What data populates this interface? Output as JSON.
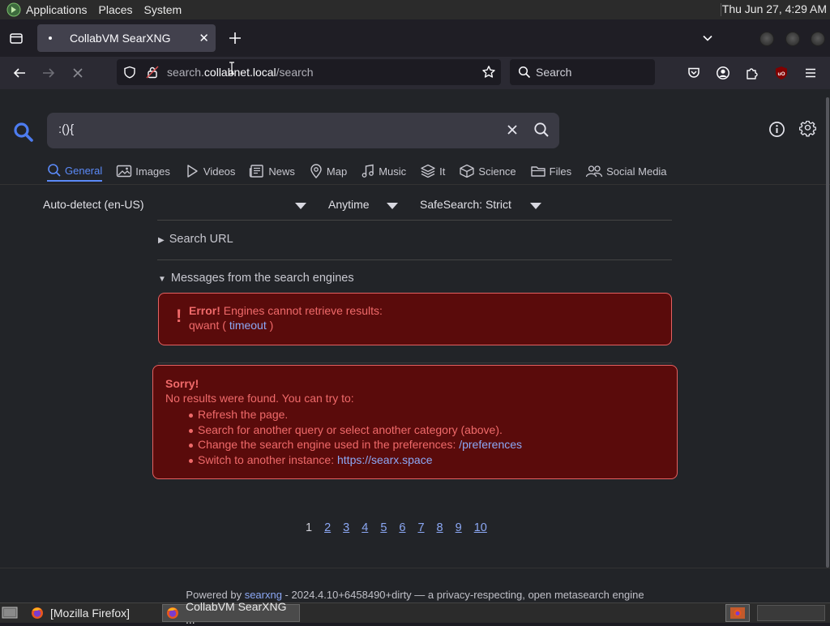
{
  "panel": {
    "applications": "Applications",
    "places": "Places",
    "system": "System",
    "clock": "Thu Jun 27,  4:29 AM"
  },
  "browser": {
    "tab_title": "CollabVM SearXNG",
    "url_prefix": "search.",
    "url_domain": "collabnet.local",
    "url_path": "/search",
    "search_placeholder": "Search"
  },
  "searx": {
    "query": ":(){",
    "categories": [
      {
        "label": "General",
        "icon": "search-icon"
      },
      {
        "label": "Images",
        "icon": "image-icon"
      },
      {
        "label": "Videos",
        "icon": "play-icon"
      },
      {
        "label": "News",
        "icon": "newspaper-icon"
      },
      {
        "label": "Map",
        "icon": "map-pin-icon"
      },
      {
        "label": "Music",
        "icon": "music-icon"
      },
      {
        "label": "It",
        "icon": "layers-icon"
      },
      {
        "label": "Science",
        "icon": "cube-icon"
      },
      {
        "label": "Files",
        "icon": "folder-icon"
      },
      {
        "label": "Social Media",
        "icon": "people-icon"
      }
    ],
    "filters": {
      "language": "Auto-detect (en-US)",
      "time": "Anytime",
      "safesearch": "SafeSearch: Strict"
    },
    "search_url_label": "Search URL",
    "messages_label": "Messages from the search engines",
    "engine_error": {
      "mark": "!",
      "bold": "Error!",
      "text": " Engines cannot retrieve results:",
      "engine": "qwant",
      "open_paren": " ( ",
      "link": "timeout",
      "close_paren": " )"
    },
    "sorry": {
      "title": "Sorry!",
      "intro": "No results were found. You can try to:",
      "items": [
        {
          "text": "Refresh the page.",
          "link": ""
        },
        {
          "text": "Search for another query or select another category (above).",
          "link": ""
        },
        {
          "text": "Change the search engine used in the preferences: ",
          "link": "/preferences"
        },
        {
          "text": "Switch to another instance: ",
          "link": "https://searx.space"
        }
      ]
    },
    "pagination": {
      "current": "1",
      "pages": [
        "2",
        "3",
        "4",
        "5",
        "6",
        "7",
        "8",
        "9",
        "10"
      ]
    },
    "footer": {
      "prefix": "Powered by ",
      "link": "searxng",
      "suffix": " - 2024.4.10+6458490+dirty — a privacy-respecting, open metasearch engine"
    }
  },
  "taskbar": {
    "task1": "[Mozilla Firefox]",
    "task2": "CollabVM SearXNG ..."
  },
  "colors": {
    "accent": "#5b8af8",
    "error_bg": "#5a0b0b",
    "error_text": "#f06a6a",
    "link": "#8ca8f5"
  }
}
